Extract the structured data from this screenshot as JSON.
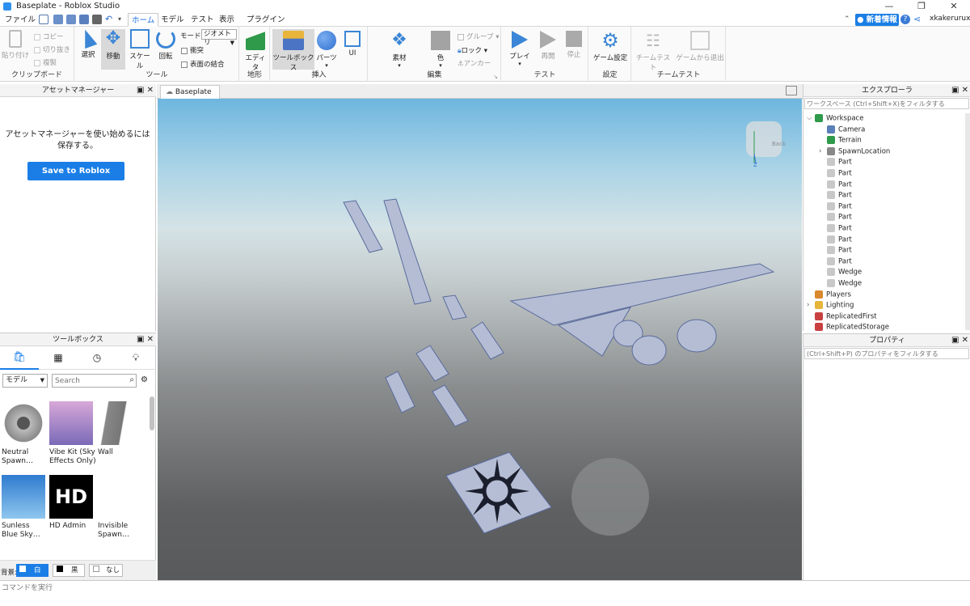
{
  "window": {
    "title": "Baseplate - Roblox Studio",
    "minimize": "—",
    "restore": "❐",
    "close": "✕"
  },
  "menu": {
    "file": "ファイル",
    "tabs": [
      "ホーム",
      "モデル",
      "テスト",
      "表示",
      "プラグイン"
    ],
    "new_info": "新着情報",
    "username": "xkakerurux"
  },
  "ribbon": {
    "clipboard": {
      "label": "クリップボード",
      "paste": "貼り付け",
      "copy": "コピー",
      "cut": "切り抜き",
      "duplicate": "複製"
    },
    "tools": {
      "label": "ツール",
      "select": "選択",
      "move": "移動",
      "scale": "スケール",
      "rotate": "回転",
      "mode_label": "モード:",
      "mode_value": "ジオメトリ",
      "collisions": "衝突",
      "join": "表面の結合"
    },
    "terrain": {
      "label": "地形",
      "editor": "エディタ"
    },
    "insert": {
      "label": "挿入",
      "toolbox": "ツールボックス",
      "part": "パーツ",
      "ui": "UI"
    },
    "edit": {
      "label": "編集",
      "material": "素材",
      "color": "色",
      "group": "グループ",
      "lock": "ロック",
      "anchor": "アンカー"
    },
    "test": {
      "label": "テスト",
      "play": "プレイ",
      "resume": "再開",
      "stop": "停止"
    },
    "settings": {
      "label": "設定",
      "game_settings": "ゲーム設定"
    },
    "team_test": {
      "label": "チームテスト",
      "team_test": "チームテスト",
      "exit": "ゲームから退出"
    }
  },
  "asset_manager": {
    "title": "アセットマネージャー",
    "message": "アセットマネージャーを使い始めるには保存する。",
    "save_button": "Save to Roblox"
  },
  "toolbox": {
    "title": "ツールボックス",
    "category": "モデル",
    "search_placeholder": "Search",
    "items": [
      {
        "name": "Neutral Spawn…"
      },
      {
        "name": "Vibe Kit (Sky Effects Only)"
      },
      {
        "name": "Wall"
      },
      {
        "name": "Sunless Blue Sky…"
      },
      {
        "name": "HD Admin"
      },
      {
        "name": "Invisible Spawn…"
      }
    ],
    "bg_label": "背景:",
    "bg_white": "白",
    "bg_black": "黒",
    "bg_none": "なし"
  },
  "document_tab": "Baseplate",
  "explorer": {
    "title": "エクスプローラ",
    "filter_placeholder": "ワークスペース (Ctrl+Shift+X)をフィルタする",
    "items": [
      {
        "label": "Workspace",
        "icon": "globe-icon"
      },
      {
        "label": "Camera",
        "icon": "camera-icon"
      },
      {
        "label": "Terrain",
        "icon": "terrain-icon"
      },
      {
        "label": "SpawnLocation",
        "icon": "spawn-icon"
      },
      {
        "label": "Part",
        "icon": "part-icon"
      },
      {
        "label": "Part",
        "icon": "part-icon"
      },
      {
        "label": "Part",
        "icon": "part-icon"
      },
      {
        "label": "Part",
        "icon": "part-icon"
      },
      {
        "label": "Part",
        "icon": "part-icon"
      },
      {
        "label": "Part",
        "icon": "part-icon"
      },
      {
        "label": "Part",
        "icon": "part-icon"
      },
      {
        "label": "Part",
        "icon": "part-icon"
      },
      {
        "label": "Part",
        "icon": "part-icon"
      },
      {
        "label": "Part",
        "icon": "part-icon"
      },
      {
        "label": "Wedge",
        "icon": "part-icon"
      },
      {
        "label": "Wedge",
        "icon": "part-icon"
      },
      {
        "label": "Players",
        "icon": "players-icon"
      },
      {
        "label": "Lighting",
        "icon": "lighting-icon"
      },
      {
        "label": "ReplicatedFirst",
        "icon": "replicated-icon"
      },
      {
        "label": "ReplicatedStorage",
        "icon": "replicated-icon"
      }
    ]
  },
  "properties": {
    "title": "プロパティ",
    "filter_placeholder": "(Ctrl+Shift+P) のプロパティをフィルタする"
  },
  "viewcube": {
    "face": "Back",
    "axis": "Z"
  },
  "command_bar": {
    "placeholder": "コマンドを実行"
  }
}
